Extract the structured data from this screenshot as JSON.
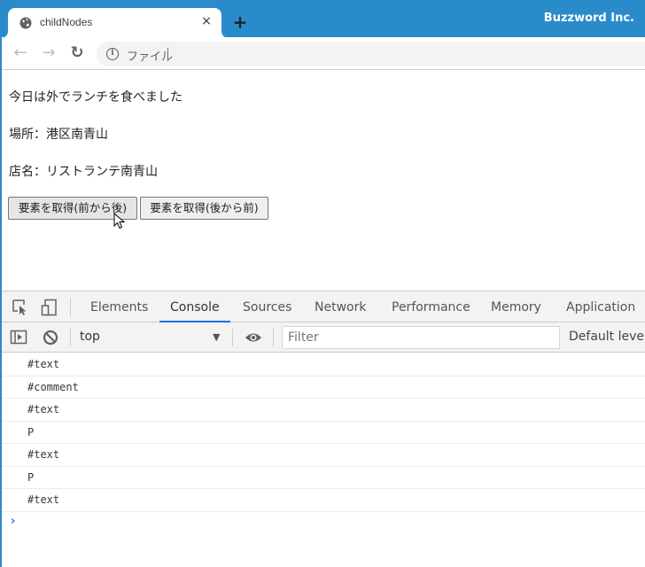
{
  "browser": {
    "tab_title": "childNodes",
    "tab_close": "×",
    "new_tab": "+",
    "brand": "Buzzword Inc.",
    "nav": {
      "back": "←",
      "forward": "→",
      "reload": "↻"
    },
    "omnibox": {
      "info": "i",
      "label": "ファイル"
    },
    "accent_color": "#2a8bcb"
  },
  "page": {
    "paragraphs": [
      "今日は外でランチを食べました",
      "場所：港区南青山",
      "店名：リストランテ南青山"
    ],
    "buttons": [
      "要素を取得(前から後)",
      "要素を取得(後から前)"
    ]
  },
  "devtools": {
    "tabs": [
      "Elements",
      "Console",
      "Sources",
      "Network",
      "Performance",
      "Memory",
      "Application"
    ],
    "active_tab": "Console",
    "context": "top",
    "filter_placeholder": "Filter",
    "levels": "Default levels",
    "log": [
      "#text",
      "#comment",
      "#text",
      "P",
      "#text",
      "P",
      "#text"
    ],
    "prompt": "›"
  }
}
